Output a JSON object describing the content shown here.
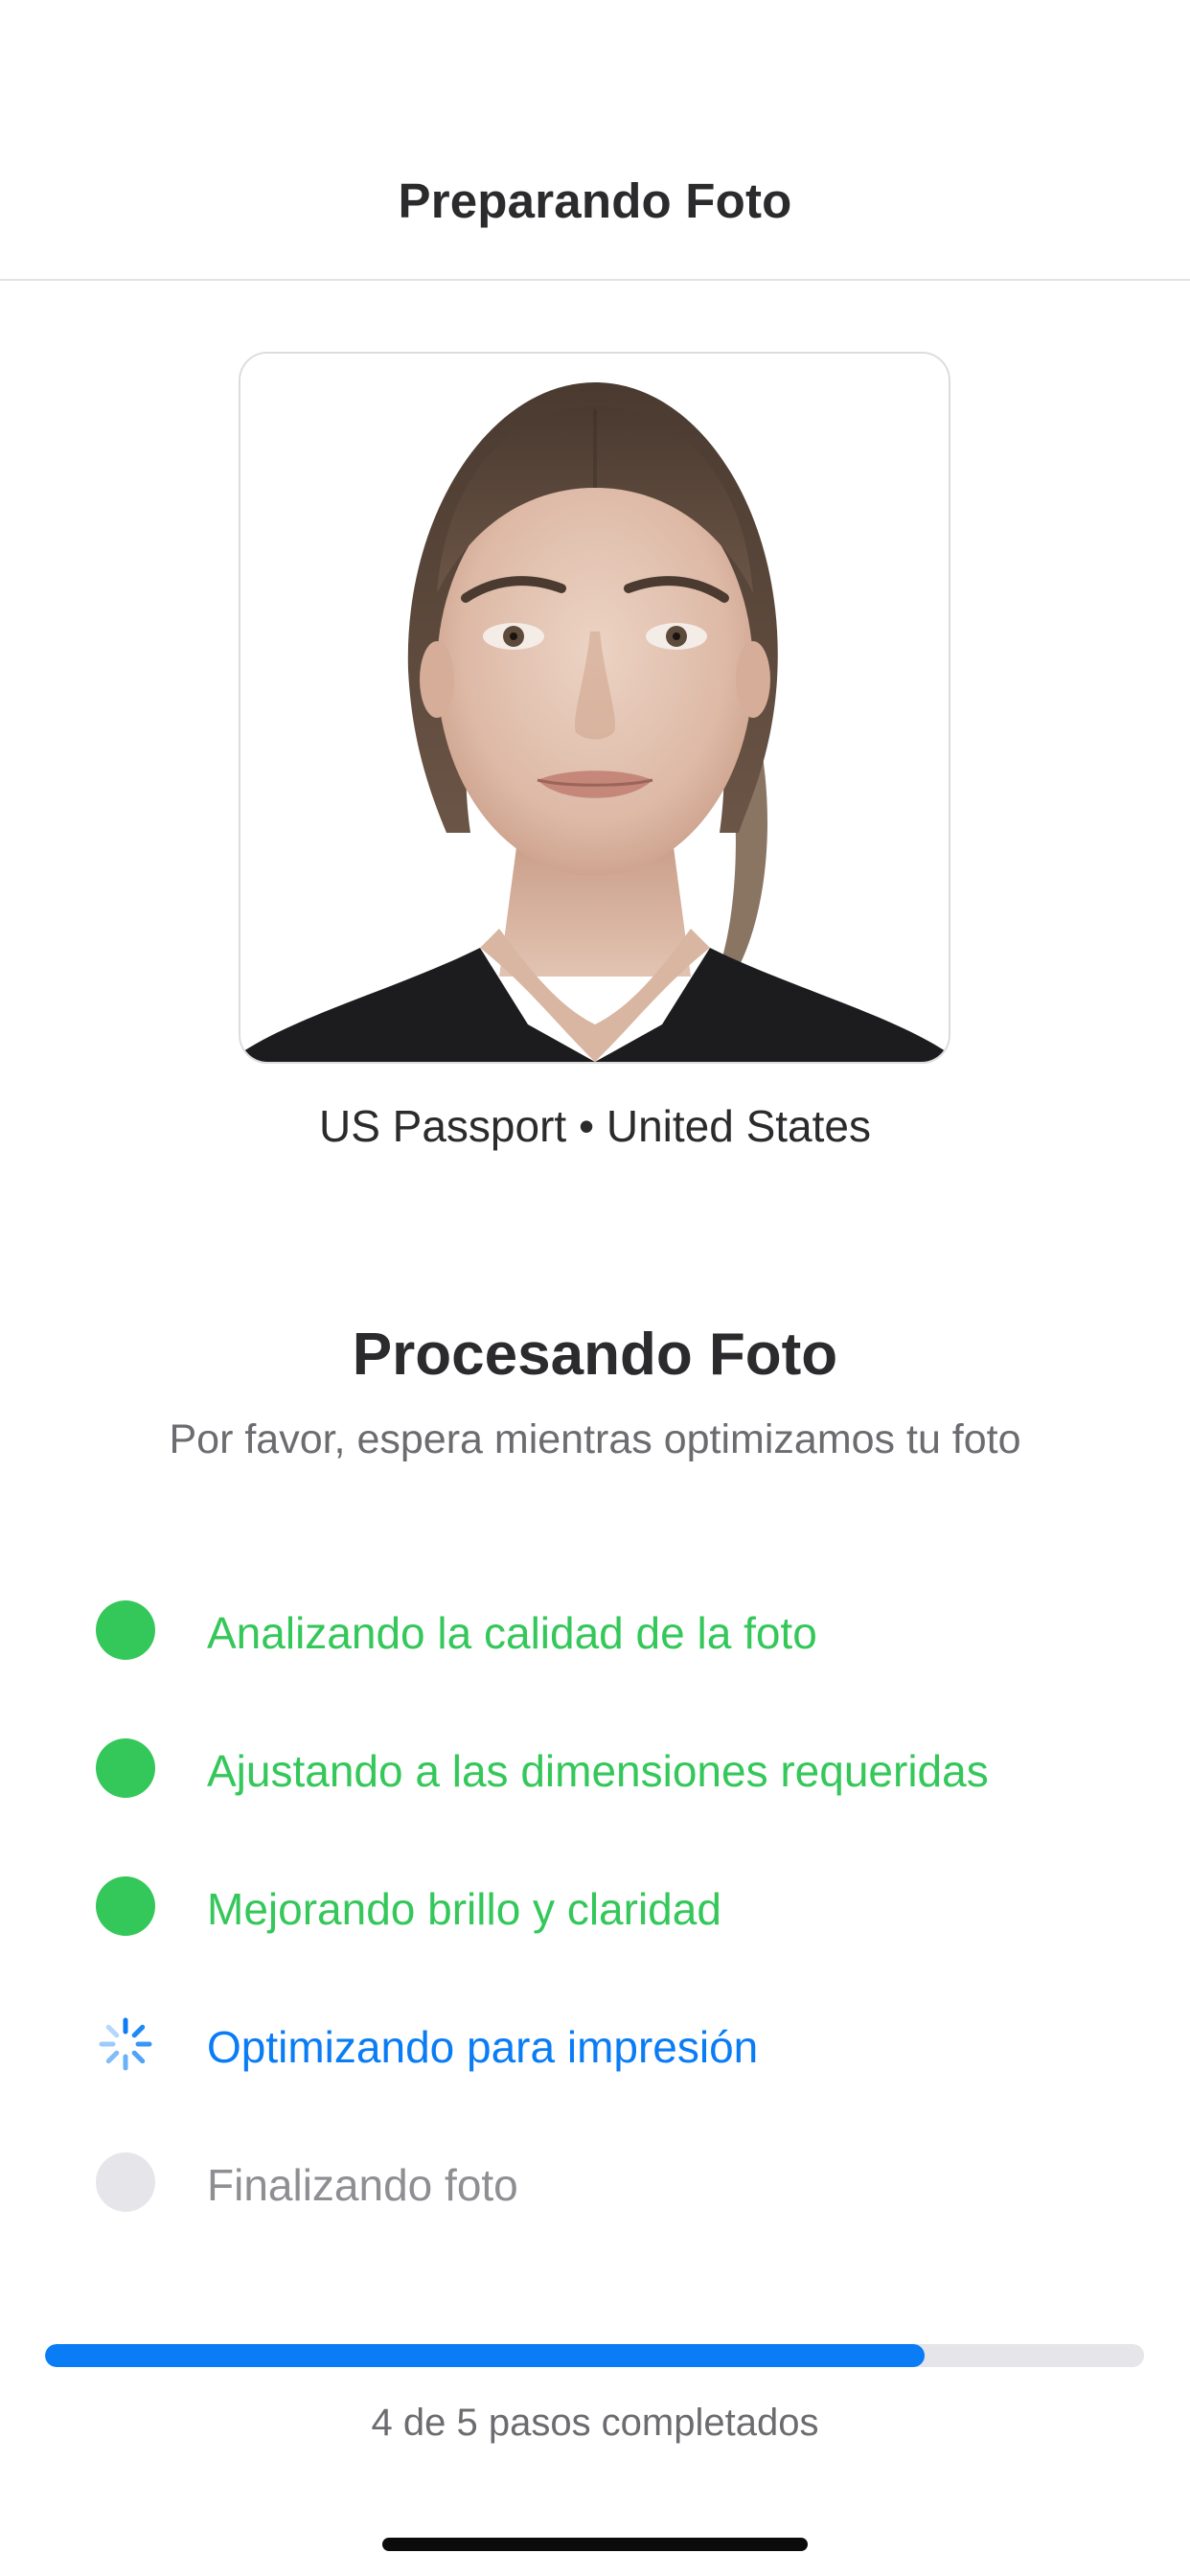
{
  "header": {
    "title": "Preparando Foto"
  },
  "photo": {
    "icon": "portrait-photo",
    "caption": "US Passport • United States"
  },
  "processing": {
    "title": "Procesando Foto",
    "subtitle": "Por favor, espera mientras optimizamos tu foto",
    "steps": [
      {
        "label": "Analizando la calidad de la foto",
        "status": "done"
      },
      {
        "label": "Ajustando a las dimensiones requeridas",
        "status": "done"
      },
      {
        "label": "Mejorando brillo y claridad",
        "status": "done"
      },
      {
        "label": "Optimizando para impresión",
        "status": "in-progress"
      },
      {
        "label": "Finalizando foto",
        "status": "pending"
      }
    ]
  },
  "progress": {
    "completed": 4,
    "total": 5,
    "fraction": 0.8,
    "label": "4 de 5 pasos completados"
  },
  "colors": {
    "done": "#34c759",
    "active": "#0a7cf5",
    "pending": "#e5e5ea",
    "track": "#e5e5ea"
  }
}
